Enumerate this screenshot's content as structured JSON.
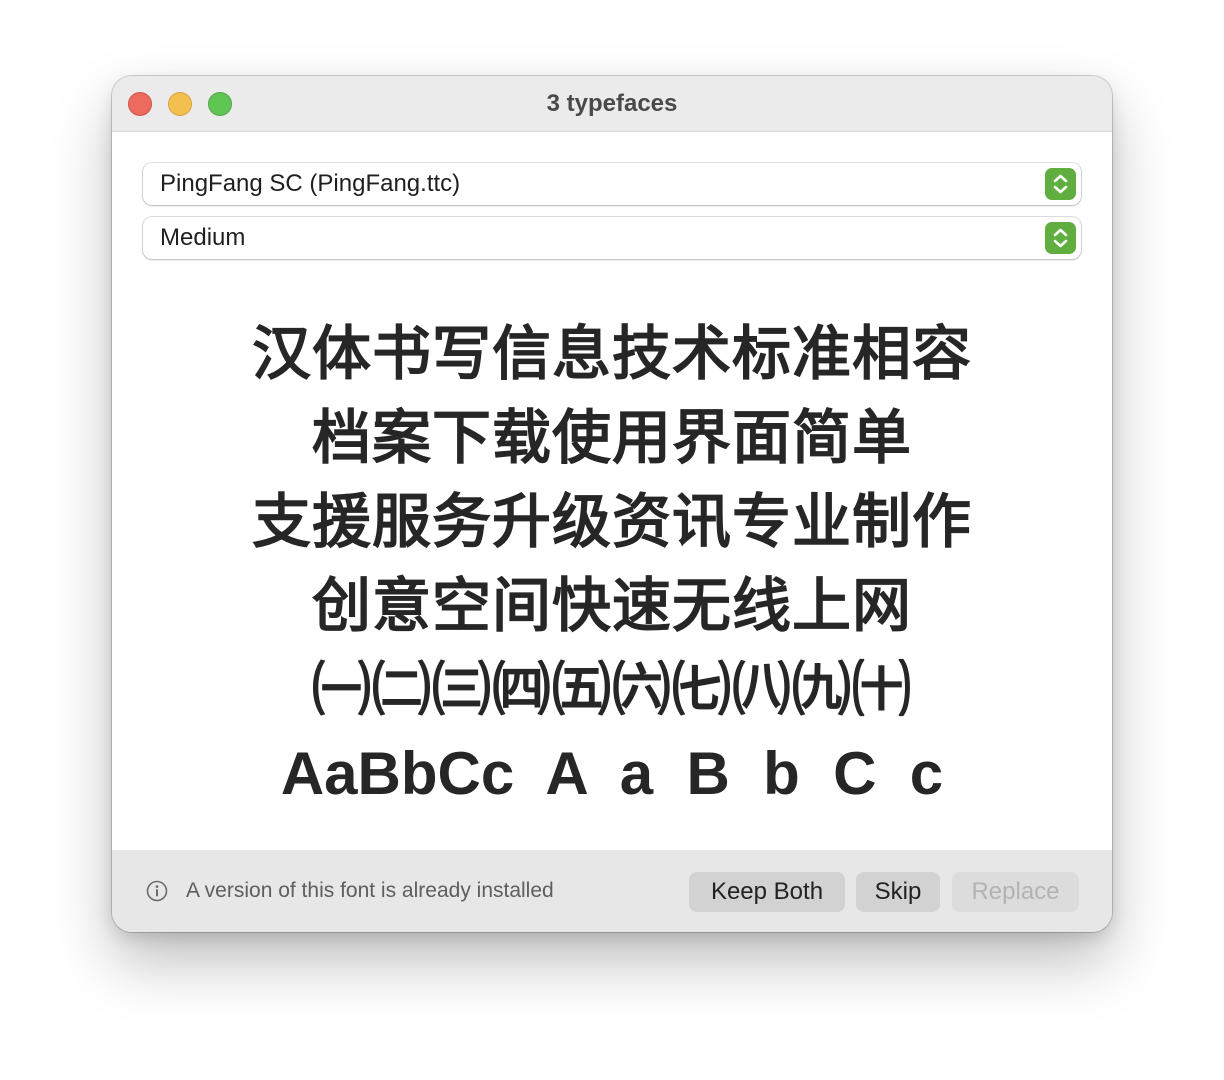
{
  "window": {
    "title": "3 typefaces"
  },
  "font_select": {
    "value": "PingFang SC (PingFang.ttc)"
  },
  "style_select": {
    "value": "Medium"
  },
  "preview": {
    "lines": [
      "汉体书写信息技术标准相容",
      "档案下载使用界面简单",
      "支援服务升级资讯专业制作",
      "创意空间快速无线上网",
      "㈠㈡㈢㈣㈤㈥㈦㈧㈨㈩",
      "AaBbCc  A  a  B  b  C  c"
    ]
  },
  "footer": {
    "info_icon": "info-circle-icon",
    "message": "A version of this font is already installed",
    "keep_both_label": "Keep Both",
    "skip_label": "Skip",
    "replace_label": "Replace"
  },
  "colors": {
    "accent": "#5fae3f",
    "close": "#ed6a5e",
    "minimize": "#f5bf4f",
    "zoom": "#61c554"
  }
}
